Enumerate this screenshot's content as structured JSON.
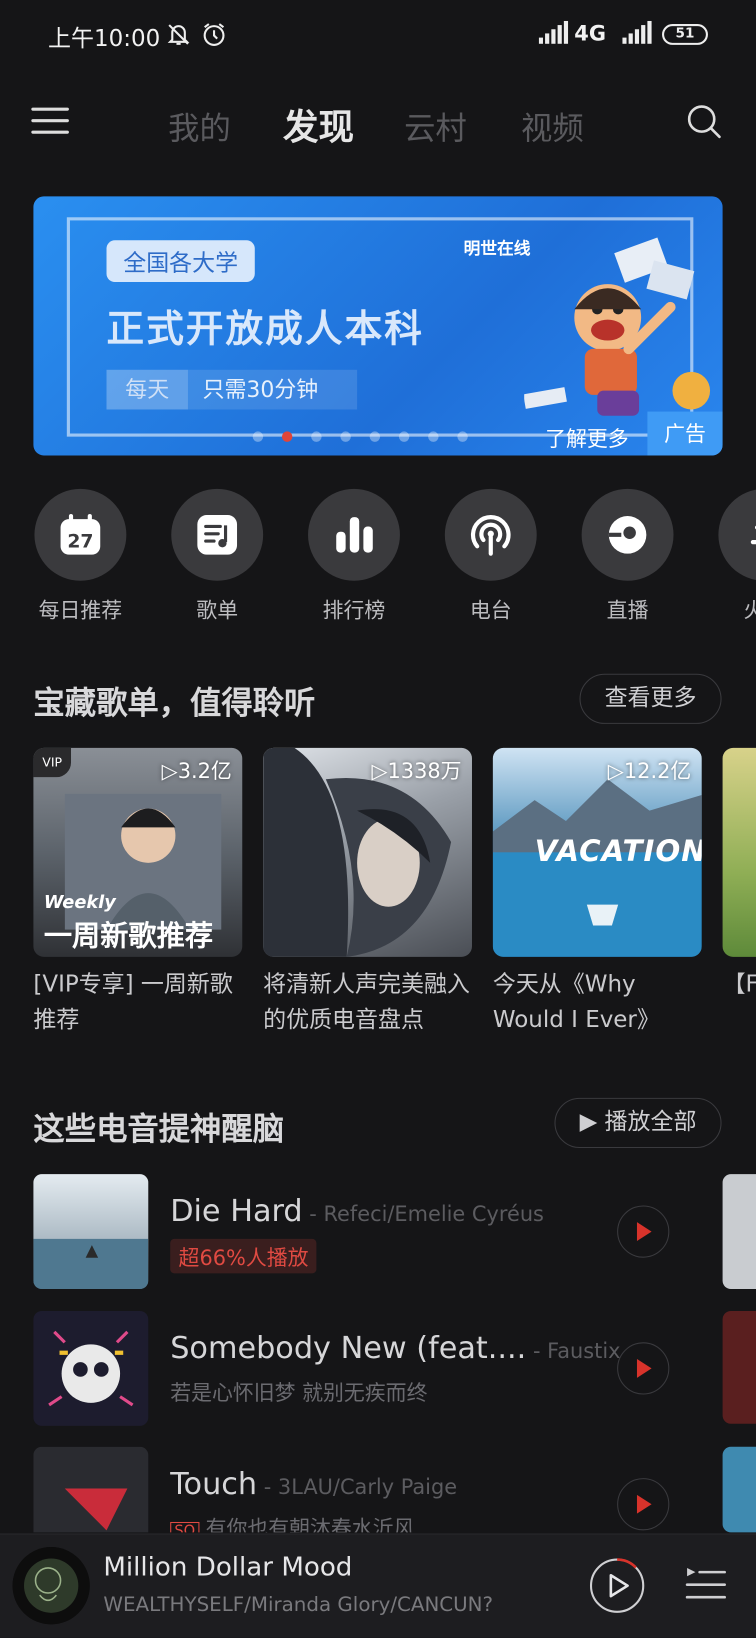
{
  "status": {
    "time": "上午10:00",
    "network": "4G",
    "battery": "51"
  },
  "nav": {
    "tabs": [
      "我的",
      "发现",
      "云村",
      "视频"
    ],
    "active": "发现"
  },
  "banner": {
    "tag": "全国各大学",
    "headline": "正式开放成人本科",
    "sub_a": "每天",
    "sub_b": "只需30分钟",
    "brand": "明世在线",
    "learn_more": "了解更多",
    "ad_label": "广告"
  },
  "quick": [
    {
      "label": "每日推荐",
      "icon": "calendar-icon",
      "day": "27"
    },
    {
      "label": "歌单",
      "icon": "playlist-icon"
    },
    {
      "label": "排行榜",
      "icon": "chart-icon"
    },
    {
      "label": "电台",
      "icon": "radio-icon"
    },
    {
      "label": "直播",
      "icon": "live-icon"
    },
    {
      "label": "火前",
      "icon": "fire-icon"
    }
  ],
  "playlists_section": {
    "title": "宝藏歌单，值得聆听",
    "more": "查看更多"
  },
  "playlists": [
    {
      "plays": "▷3.2亿",
      "title": "[VIP专享] 一周新歌推荐",
      "cover_text_top": "Weekly",
      "cover_text": "一周新歌推荐",
      "badge": "VIP"
    },
    {
      "plays": "▷1338万",
      "title": "将清新人声完美融入的优质电音盘点"
    },
    {
      "plays": "▷12.2亿",
      "title": "今天从《Why Would I Ever》听...",
      "cover_text": "VACATION"
    },
    {
      "plays": "",
      "title": "【F耳朵"
    }
  ],
  "songs_section": {
    "title": "这些电音提神醒脑",
    "play_all": "播放全部"
  },
  "songs": [
    {
      "name": "Die Hard",
      "artist": " - Refeci/Emelie Cyréus",
      "meta": "超66%人播放",
      "hot": true
    },
    {
      "name": "Somebody New (feat....",
      "artist": " - Faustix",
      "meta": "若是心怀旧梦 就别无疾而终",
      "hot": false
    },
    {
      "name": "Touch",
      "artist": " - 3LAU/Carly Paige",
      "meta": "有你也有朝沐春水沂风",
      "hot": false,
      "sq": "SQ"
    }
  ],
  "player": {
    "title": "Million Dollar Mood",
    "artist": "WEALTHYSELF/Miranda Glory/CANCUN?"
  },
  "colors": {
    "accent": "#e0453a",
    "background": "#151517",
    "banner": "#2a8ff0"
  }
}
